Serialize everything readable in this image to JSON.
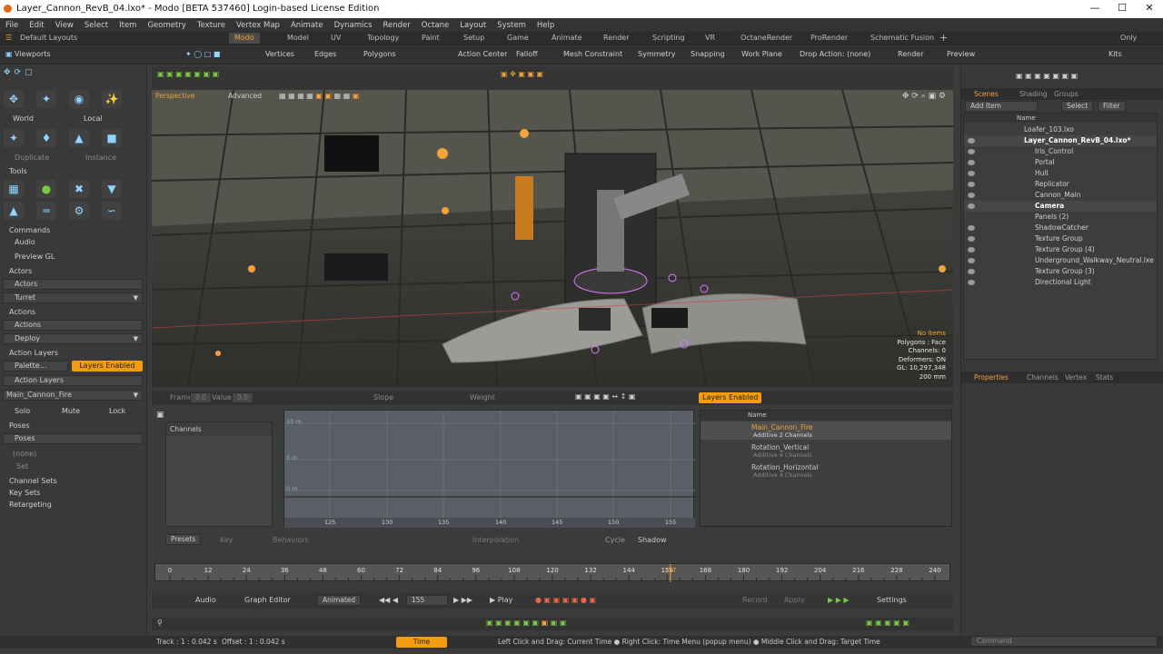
{
  "window": {
    "title": "Layer_Cannon_RevB_04.lxo* - Modo [BETA 537460] Login-based License Edition"
  },
  "menu": [
    "File",
    "Edit",
    "View",
    "Select",
    "Item",
    "Geometry",
    "Texture",
    "Vertex Map",
    "Animate",
    "Dynamics",
    "Render",
    "Octane",
    "Layout",
    "System",
    "Help"
  ],
  "layouts": {
    "label": "Default Layouts",
    "tabs": [
      "Modo",
      "Model",
      "UV",
      "Topology",
      "Paint",
      "Setup",
      "Game",
      "Animate",
      "Render",
      "Scripting",
      "VR",
      "OctaneRender",
      "ProRender",
      "Schematic Fusion"
    ],
    "only": "Only"
  },
  "toolbar": {
    "viewports": "Viewports",
    "vertices": "Vertices",
    "edges": "Edges",
    "polygons": "Polygons",
    "action_center": "Action Center",
    "falloff": "Falloff",
    "mesh_constraint": "Mesh Constraint",
    "symmetry": "Symmetry",
    "snapping": "Snapping",
    "work_plane": "Work Plane",
    "drop_action": "Drop Action: (none)",
    "render": "Render",
    "preview": "Preview",
    "kits": "Kits"
  },
  "left": {
    "world": "World",
    "local": "Local",
    "duplicate": "Duplicate",
    "instance": "Instance",
    "tools": "Tools",
    "commands": "Commands",
    "audio": "Audio",
    "preview_gl": "Preview GL",
    "actors_head": "Actors",
    "actors_item": "Actors",
    "turret": "Turret",
    "actions_head": "Actions",
    "actions_item": "Actions",
    "deploy": "Deploy",
    "action_layers_head": "Action Layers",
    "palette": "Palette...",
    "layers_enabled": "Layers Enabled",
    "action_layers_item": "Action Layers",
    "main_cannon": "Main_Cannon_Fire",
    "solo": "Solo",
    "mute": "Mute",
    "lock": "Lock",
    "poses_head": "Poses",
    "poses_item": "Poses",
    "none": "(none)",
    "set": "Set",
    "channel_sets": "Channel Sets",
    "key_sets": "Key Sets",
    "retargeting": "Retargeting"
  },
  "viewport": {
    "mode": "Perspective",
    "shading": "Advanced",
    "info": [
      "No Items",
      "Polygons : Face",
      "Channels: 0",
      "Deformers: ON",
      "GL: 10,297,348",
      "200 mm"
    ]
  },
  "anim": {
    "frame": "Frame",
    "frame_val": "0.0",
    "value": "Value",
    "value_val": "0.0",
    "slope": "Slope",
    "weight": "Weight",
    "layers_enabled": "Layers Enabled",
    "channels": "Channels",
    "name_col": "Name",
    "graph_x": [
      "125",
      "130",
      "135",
      "140",
      "145",
      "150",
      "155"
    ],
    "graph_y": [
      "10 m",
      "5 m",
      "0 m"
    ],
    "layers": [
      {
        "name": "Main_Cannon_Fire",
        "detail": "Additive   2 Channels"
      },
      {
        "name": "Rotation_Vertical",
        "detail": "Additive   4 Channels"
      },
      {
        "name": "Rotation_Horizontal",
        "detail": "Additive   4 Channels"
      }
    ],
    "presets": "Presets",
    "key": "Key",
    "behaviors": "Behaviors",
    "interpolation": "Interpolation",
    "cycle": "Cycle",
    "shadow": "Shadow"
  },
  "timeline": {
    "ticks": [
      "0",
      "12",
      "24",
      "36",
      "48",
      "60",
      "72",
      "84",
      "96",
      "108",
      "120",
      "132",
      "144",
      "156",
      "168",
      "180",
      "192",
      "204",
      "216",
      "228",
      "240"
    ],
    "current": "157"
  },
  "playbar": {
    "audio": "Audio",
    "graph_editor": "Graph Editor",
    "animated": "Animated",
    "frame": "155",
    "play": "Play",
    "record": "Record",
    "apply": "Apply",
    "settings": "Settings"
  },
  "status": {
    "track": "Track : 1 : 0.042 s",
    "offset": "Offset : 1 : 0.042 s",
    "time": "Time",
    "hint": "Left Click and Drag: Current Time ● Right Click: Time Menu (popup menu) ● Middle Click and Drag: Target Time",
    "command": "Command"
  },
  "right": {
    "tabs": [
      "Scenes",
      "Shading",
      "Groups"
    ],
    "add_item": "Add Item",
    "select": "Select",
    "filter": "Filter",
    "name_col": "Name",
    "items": [
      {
        "label": "Loafer_103.lxo",
        "indent": 0,
        "style": "normal",
        "eye": false
      },
      {
        "label": "Layer_Cannon_RevB_04.lxo*",
        "indent": 0,
        "style": "bold",
        "eye": true
      },
      {
        "label": "Iris_Control",
        "indent": 2,
        "style": "normal",
        "eye": true
      },
      {
        "label": "Portal",
        "indent": 2,
        "style": "normal",
        "eye": true
      },
      {
        "label": "Hull",
        "indent": 2,
        "style": "normal",
        "eye": true
      },
      {
        "label": "Replicator",
        "indent": 2,
        "style": "normal",
        "eye": true
      },
      {
        "label": "Cannon_Main",
        "indent": 2,
        "style": "normal",
        "eye": true
      },
      {
        "label": "Camera",
        "indent": 2,
        "style": "bold",
        "eye": true
      },
      {
        "label": "Panels (2)",
        "indent": 2,
        "style": "normal",
        "eye": false
      },
      {
        "label": "ShadowCatcher",
        "indent": 2,
        "style": "normal",
        "eye": true
      },
      {
        "label": "Texture Group",
        "indent": 2,
        "style": "normal",
        "eye": true
      },
      {
        "label": "Texture Group (4)",
        "indent": 2,
        "style": "normal",
        "eye": true
      },
      {
        "label": "Underground_Walkway_Neutral.lxe",
        "indent": 2,
        "style": "normal",
        "eye": true
      },
      {
        "label": "Texture Group (3)",
        "indent": 2,
        "style": "normal",
        "eye": true
      },
      {
        "label": "Directional Light",
        "indent": 2,
        "style": "normal",
        "eye": true
      }
    ],
    "prop_tabs": [
      "Properties",
      "Channels",
      "Vertex",
      "Stats"
    ]
  }
}
